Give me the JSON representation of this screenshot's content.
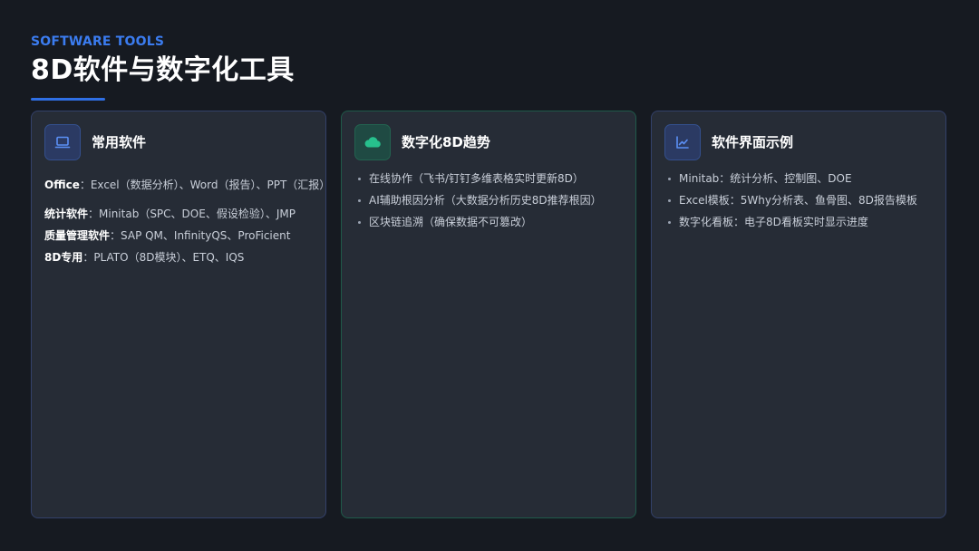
{
  "header": {
    "eyebrow": "SOFTWARE TOOLS",
    "title": "8D软件与数字化工具"
  },
  "cards": [
    {
      "title": "常用软件",
      "icon": "laptop-icon",
      "rows": [
        {
          "key": "Office",
          "value": "：Excel（数据分析）、Word（报告）、PPT（汇报）"
        },
        {
          "key": "统计软件",
          "value": "：Minitab（SPC、DOE、假设检验）、JMP"
        },
        {
          "key": "质量管理软件",
          "value": "：SAP QM、InfinityQS、ProFicient"
        },
        {
          "key": "8D专用",
          "value": "：PLATO（8D模块）、ETQ、IQS"
        }
      ]
    },
    {
      "title": "数字化8D趋势",
      "icon": "cloud-icon",
      "items": [
        "在线协作（飞书/钉钉多维表格实时更新8D）",
        "AI辅助根因分析（大数据分析历史8D推荐根因）",
        "区块链追溯（确保数据不可篡改）"
      ]
    },
    {
      "title": "软件界面示例",
      "icon": "chart-line-icon",
      "items": [
        "Minitab：统计分析、控制图、DOE",
        "Excel模板：5Why分析表、鱼骨图、8D报告模板",
        "数字化看板：电子8D看板实时显示进度"
      ]
    }
  ],
  "colors": {
    "background": "#161a21",
    "card": "#262c36",
    "accent_blue": "#3b7cf0",
    "accent_green": "#27c08d"
  }
}
